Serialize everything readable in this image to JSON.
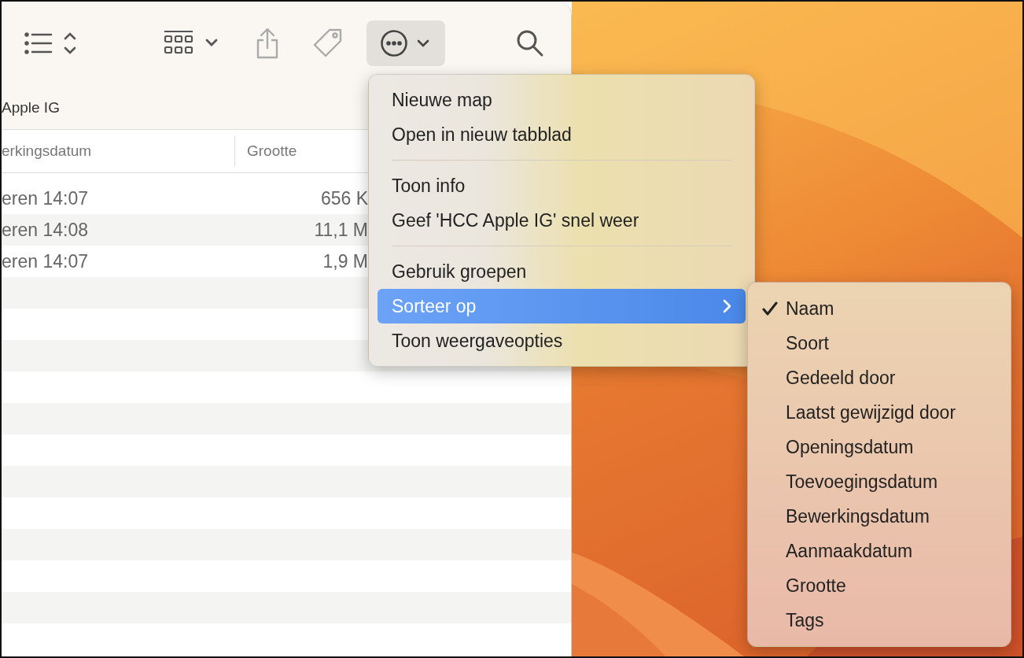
{
  "toolbar": [
    {
      "kind": "list-view",
      "selected": false
    },
    {
      "kind": "grid-view",
      "selected": false
    },
    {
      "kind": "share",
      "selected": false
    },
    {
      "kind": "tag",
      "selected": false
    },
    {
      "kind": "more",
      "selected": true
    },
    {
      "kind": "search",
      "selected": false
    }
  ],
  "path": "Apple IG",
  "columns": [
    "erkingsdatum",
    "Grootte"
  ],
  "rows": [
    {
      "date": "eren 14:07",
      "size": "656 K"
    },
    {
      "date": "eren 14:08",
      "size": "11,1 M"
    },
    {
      "date": "eren 14:07",
      "size": "1,9 M"
    }
  ],
  "menu": {
    "groups": [
      [
        {
          "label": "Nieuwe map",
          "selected": false,
          "has_submenu": false
        },
        {
          "label": "Open in nieuw tabblad",
          "selected": false,
          "has_submenu": false
        }
      ],
      [
        {
          "label": "Toon info",
          "selected": false,
          "has_submenu": false
        },
        {
          "label": "Geef 'HCC Apple IG' snel weer",
          "selected": false,
          "has_submenu": false
        }
      ],
      [
        {
          "label": "Gebruik groepen",
          "selected": false,
          "has_submenu": false
        },
        {
          "label": "Sorteer op",
          "selected": true,
          "has_submenu": true
        },
        {
          "label": "Toon weergaveopties",
          "selected": false,
          "has_submenu": false
        }
      ]
    ]
  },
  "submenu": [
    {
      "label": "Naam",
      "checked": true
    },
    {
      "label": "Soort",
      "checked": false
    },
    {
      "label": "Gedeeld door",
      "checked": false
    },
    {
      "label": "Laatst gewijzigd door",
      "checked": false
    },
    {
      "label": "Openingsdatum",
      "checked": false
    },
    {
      "label": "Toevoegingsdatum",
      "checked": false
    },
    {
      "label": "Bewerkingsdatum",
      "checked": false
    },
    {
      "label": "Aanmaakdatum",
      "checked": false
    },
    {
      "label": "Grootte",
      "checked": false
    },
    {
      "label": "Tags",
      "checked": false
    }
  ]
}
